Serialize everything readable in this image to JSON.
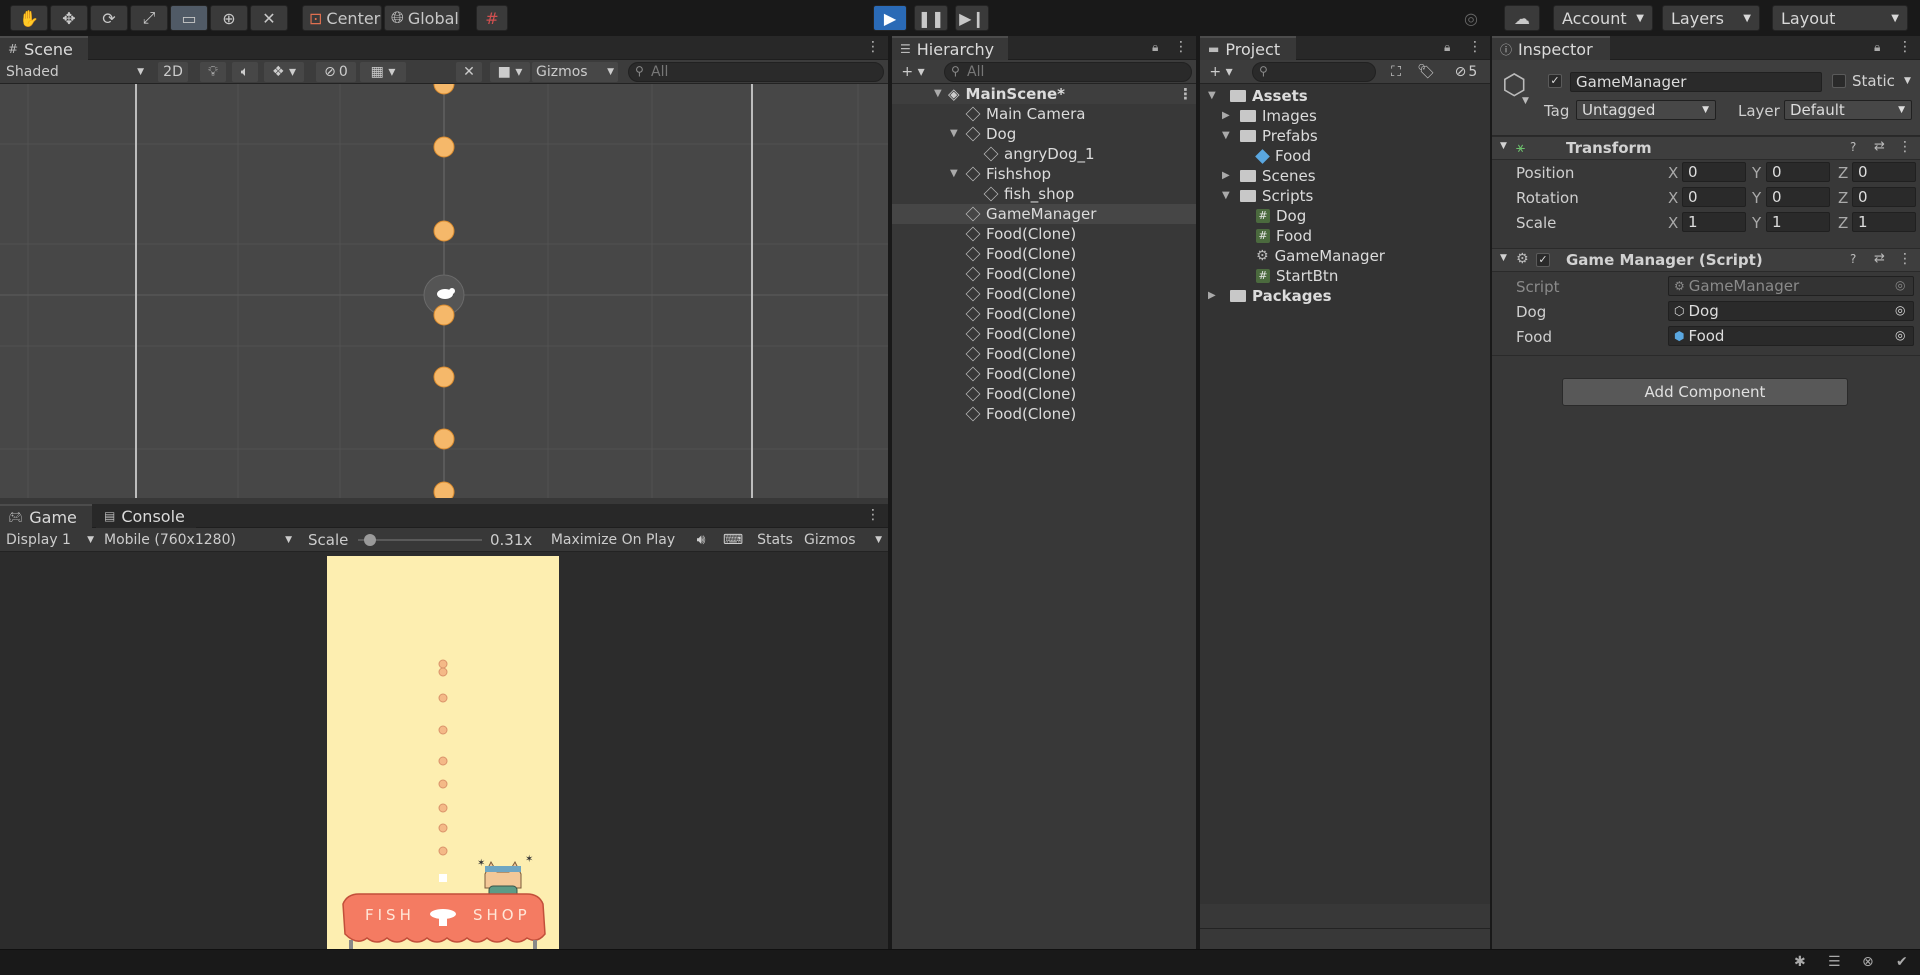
{
  "toolbar": {
    "pivot_label": "Center",
    "space_label": "Global",
    "account_label": "Account",
    "layers_label": "Layers",
    "layout_label": "Layout"
  },
  "scene": {
    "tab_label": "Scene",
    "shading_mode": "Shaded",
    "btn_2d": "2D",
    "hidden_count": "0",
    "gizmos_label": "Gizmos",
    "search_placeholder": "All"
  },
  "game": {
    "tab_label": "Game",
    "console_tab_label": "Console",
    "display_label": "Display 1",
    "resolution_label": "Mobile (760x1280)",
    "scale_label": "Scale",
    "scale_value": "0.31x",
    "maximize_label": "Maximize On Play",
    "stats_label": "Stats",
    "gizmos_label": "Gizmos",
    "sign_text_left": "FISH",
    "sign_text_right": "SHOP",
    "scale_fraction": 0.05
  },
  "hierarchy": {
    "tab_label": "Hierarchy",
    "search_placeholder": "All",
    "scene_name": "MainScene*",
    "items": [
      {
        "label": "Main Camera"
      },
      {
        "label": "Dog"
      },
      {
        "label": "angryDog_1"
      },
      {
        "label": "Fishshop"
      },
      {
        "label": "fish_shop"
      },
      {
        "label": "GameManager"
      },
      {
        "label": "Food(Clone)"
      },
      {
        "label": "Food(Clone)"
      },
      {
        "label": "Food(Clone)"
      },
      {
        "label": "Food(Clone)"
      },
      {
        "label": "Food(Clone)"
      },
      {
        "label": "Food(Clone)"
      },
      {
        "label": "Food(Clone)"
      },
      {
        "label": "Food(Clone)"
      },
      {
        "label": "Food(Clone)"
      },
      {
        "label": "Food(Clone)"
      }
    ]
  },
  "project": {
    "tab_label": "Project",
    "hidden_count": "5",
    "items": [
      {
        "label": "Assets"
      },
      {
        "label": "Images"
      },
      {
        "label": "Prefabs"
      },
      {
        "label": "Food"
      },
      {
        "label": "Scenes"
      },
      {
        "label": "Scripts"
      },
      {
        "label": "Dog"
      },
      {
        "label": "Food"
      },
      {
        "label": "GameManager"
      },
      {
        "label": "StartBtn"
      },
      {
        "label": "Packages"
      }
    ]
  },
  "inspector": {
    "tab_label": "Inspector",
    "object_name": "GameManager",
    "static_label": "Static",
    "tag_label": "Tag",
    "tag_value": "Untagged",
    "layer_label": "Layer",
    "layer_value": "Default",
    "transform": {
      "title": "Transform",
      "position_label": "Position",
      "rotation_label": "Rotation",
      "scale_label": "Scale",
      "x_label": "X",
      "y_label": "Y",
      "z_label": "Z",
      "position": {
        "x": "0",
        "y": "0",
        "z": "0"
      },
      "rotation": {
        "x": "0",
        "y": "0",
        "z": "0"
      },
      "scale": {
        "x": "1",
        "y": "1",
        "z": "1"
      }
    },
    "script_component": {
      "title": "Game Manager (Script)",
      "script_label": "Script",
      "script_value": "GameManager",
      "dog_label": "Dog",
      "dog_value": "Dog",
      "food_label": "Food",
      "food_value": "Food"
    },
    "add_component_label": "Add Component"
  }
}
